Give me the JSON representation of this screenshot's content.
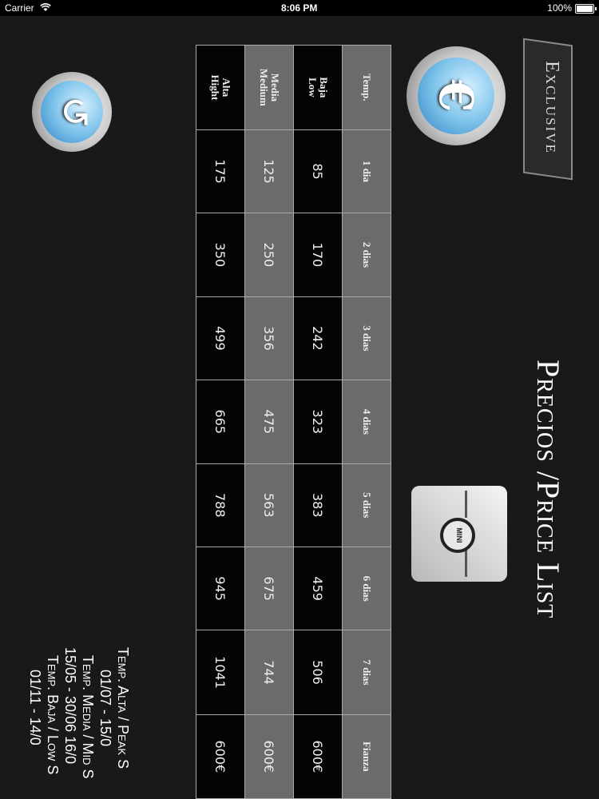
{
  "status_bar": {
    "carrier": "Carrier",
    "time": "8:06 PM",
    "battery": "100%"
  },
  "title": "Precios /Price List",
  "brand": {
    "name": "Exclusive"
  },
  "mini_logo_text": "MINI",
  "euro_button_symbol": "€",
  "back_button_symbol": "↺",
  "table": {
    "header": [
      "Temp.",
      "1 dia",
      "2 dias",
      "3 dias",
      "4 dias",
      "5 dias",
      "6 dias",
      "7 dias",
      "Fianza"
    ],
    "rows": [
      {
        "label1": "Baja",
        "label2": "Low",
        "values": [
          "85",
          "170",
          "242",
          "323",
          "383",
          "459",
          "506",
          "600€"
        ]
      },
      {
        "label1": "Media",
        "label2": "Medium",
        "values": [
          "125",
          "250",
          "356",
          "475",
          "563",
          "675",
          "744",
          "600€"
        ]
      },
      {
        "label1": "Alta",
        "label2": "Hight",
        "values": [
          "175",
          "350",
          "499",
          "665",
          "788",
          "945",
          "1041",
          "600€"
        ]
      }
    ]
  },
  "seasons": [
    "Temp. Alta / Peak S",
    "01/07 - 15/0",
    "Temp. Media / Mid S",
    "15/05 - 30/06    16/0",
    "Temp. Baja / Low S",
    "01/11 - 14/0"
  ],
  "colors": {
    "background": "#1a1819",
    "grey_row": "#6c6a6b",
    "black_row": "#050505",
    "accent_blue": "#2c83c4"
  }
}
